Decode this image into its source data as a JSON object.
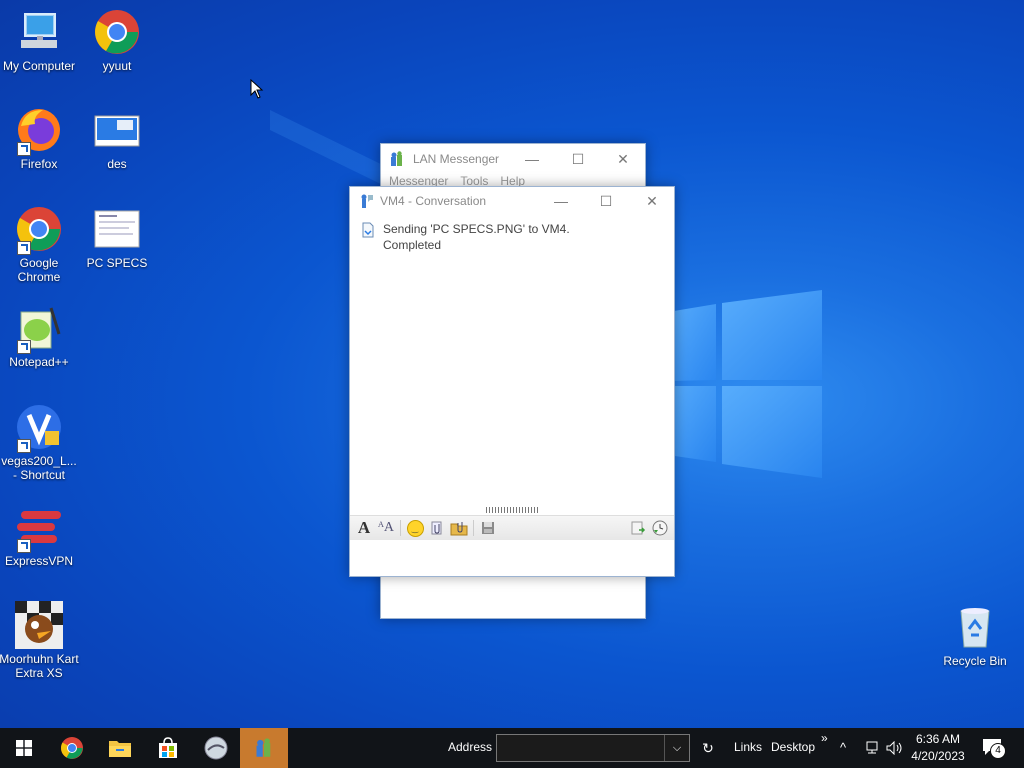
{
  "desktop": {
    "icons": [
      {
        "label": "My Computer"
      },
      {
        "label": "yyuut"
      },
      {
        "label": "Firefox"
      },
      {
        "label": "des"
      },
      {
        "label": "Google Chrome"
      },
      {
        "label": "PC SPECS"
      },
      {
        "label": "Notepad++"
      },
      {
        "label": "vegas200_L... - Shortcut"
      },
      {
        "label": "ExpressVPN"
      },
      {
        "label": "Moorhuhn Kart Extra XS"
      },
      {
        "label": "Recycle Bin"
      }
    ]
  },
  "lan_messenger": {
    "title": "LAN Messenger",
    "menu": [
      "Messenger",
      "Tools",
      "Help"
    ]
  },
  "conversation": {
    "title": "VM4 - Conversation",
    "message_line1": "Sending 'PC SPECS.PNG' to VM4.",
    "message_line2": "Completed"
  },
  "taskbar": {
    "address_label": "Address",
    "links_label": "Links",
    "desktop_label": "Desktop",
    "more_label": "»",
    "time": "6:36 AM",
    "date": "4/20/2023",
    "notification_count": "4"
  },
  "colors": {
    "taskbar_active": "#c87a2e",
    "wallpaper": "#0b56d0"
  }
}
